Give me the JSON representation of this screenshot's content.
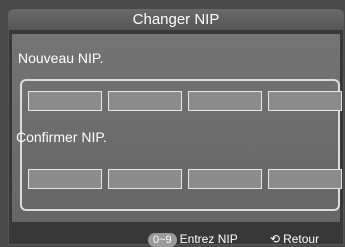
{
  "dialog": {
    "title": "Changer NIP",
    "new_pin_label": "Nouveau NIP.",
    "confirm_pin_label": "Confirmer NIP.",
    "new_pin_boxes": [
      "",
      "",
      "",
      ""
    ],
    "confirm_pin_boxes": [
      "",
      "",
      "",
      ""
    ]
  },
  "footer": {
    "digits_key": "0~9",
    "digits_text": "Entrez NIP",
    "return_icon": "return-arrow-icon",
    "return_text": "Retour"
  }
}
